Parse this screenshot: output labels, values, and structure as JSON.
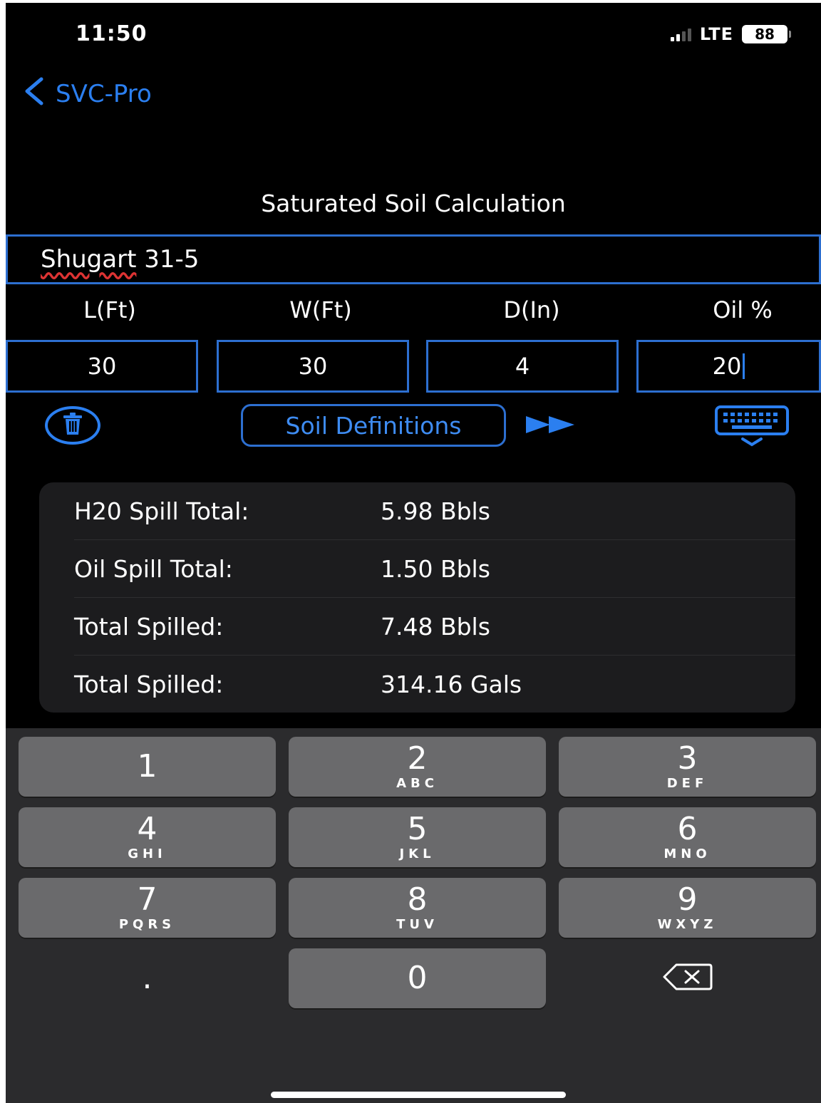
{
  "status_bar": {
    "time": "11:50",
    "network": "LTE",
    "battery": "88"
  },
  "nav": {
    "back_label": "SVC-Pro"
  },
  "page_title": "Saturated Soil Calculation",
  "site_name": {
    "word1": "Shugart",
    "rest": " 31-5"
  },
  "fields": [
    {
      "label": "L(Ft)",
      "value": "30"
    },
    {
      "label": "W(Ft)",
      "value": "30"
    },
    {
      "label": "D(In)",
      "value": "4"
    },
    {
      "label": "Oil %",
      "value": "20"
    }
  ],
  "actions": {
    "soil_definitions": "Soil Definitions"
  },
  "results": [
    {
      "label": "H20 Spill Total:",
      "value": "5.98 Bbls"
    },
    {
      "label": "Oil Spill Total:",
      "value": "1.50 Bbls"
    },
    {
      "label": "Total Spilled:",
      "value": "7.48 Bbls"
    },
    {
      "label": "Total Spilled:",
      "value": "314.16 Gals"
    }
  ],
  "keypad": {
    "k1": {
      "num": "1",
      "sub": ""
    },
    "k2": {
      "num": "2",
      "sub": "ABC"
    },
    "k3": {
      "num": "3",
      "sub": "DEF"
    },
    "k4": {
      "num": "4",
      "sub": "GHI"
    },
    "k5": {
      "num": "5",
      "sub": "JKL"
    },
    "k6": {
      "num": "6",
      "sub": "MNO"
    },
    "k7": {
      "num": "7",
      "sub": "PQRS"
    },
    "k8": {
      "num": "8",
      "sub": "TUV"
    },
    "k9": {
      "num": "9",
      "sub": "WXYZ"
    },
    "dot": ".",
    "k0": "0"
  },
  "icons": {
    "back": "chevron-left-icon",
    "trash": "trash-icon",
    "forward": "fast-forward-icon",
    "keyboard": "keyboard-dismiss-icon",
    "delete": "delete-key-icon"
  },
  "colors": {
    "accent": "#2b7ff0",
    "background": "#000000",
    "keyboard": "#2b2b2d",
    "key": "#6a6a6c"
  }
}
